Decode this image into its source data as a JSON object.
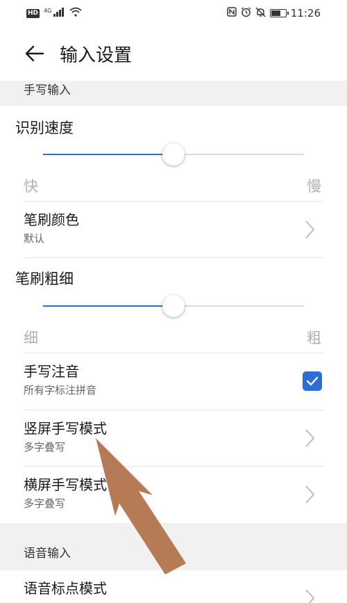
{
  "status_bar": {
    "hd": "HD",
    "network": "4G",
    "time": "11:26",
    "icons": [
      "nfc-icon",
      "alarm-icon",
      "mute-icon",
      "battery-icon"
    ]
  },
  "header": {
    "title": "输入设置"
  },
  "handwriting": {
    "section_label": "手写输入",
    "speed": {
      "label": "识别速度",
      "min_label": "快",
      "max_label": "慢",
      "value_fraction": 0.5
    },
    "brush_color": {
      "title": "笔刷颜色",
      "value": "默认"
    },
    "brush_width": {
      "label": "笔刷粗细",
      "min_label": "细",
      "max_label": "粗",
      "value_fraction": 0.5
    },
    "phonetic": {
      "title": "手写注音",
      "subtitle": "所有字标注拼音",
      "checked": true
    },
    "portrait_mode": {
      "title": "竖屏手写模式",
      "value": "多字叠写"
    },
    "landscape_mode": {
      "title": "横屏手写模式",
      "value": "多字叠写"
    }
  },
  "voice": {
    "section_label": "语音输入",
    "punctuation_mode": {
      "title": "语音标点模式"
    }
  },
  "colors": {
    "accent": "#2b6fd6",
    "section_bg": "#f1f1f1",
    "annotation_arrow": "#b77a56"
  }
}
